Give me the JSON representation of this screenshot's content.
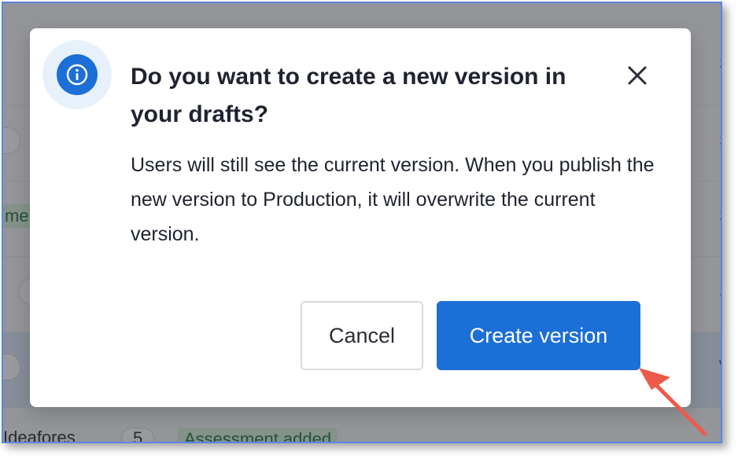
{
  "dialog": {
    "title": "Do you want to create a new version in your drafts?",
    "body": "Users will still see the current version. When you publish the new version to Production, it will overwrite the current version.",
    "cancel_label": "Cancel",
    "confirm_label": "Create version",
    "icon": "info-icon"
  },
  "background": {
    "row_tag_partial": "me",
    "bottom_text_partial": "Ideafores",
    "bottom_count": "5",
    "bottom_tag": "Assessment added",
    "right_letters": [
      "S",
      "S",
      "S",
      "S",
      "W"
    ]
  },
  "colors": {
    "primary": "#1c6fd6",
    "overlay": "#1c1f26",
    "annotation_arrow": "#ee5a4a",
    "frame_border": "#5a86e8"
  }
}
